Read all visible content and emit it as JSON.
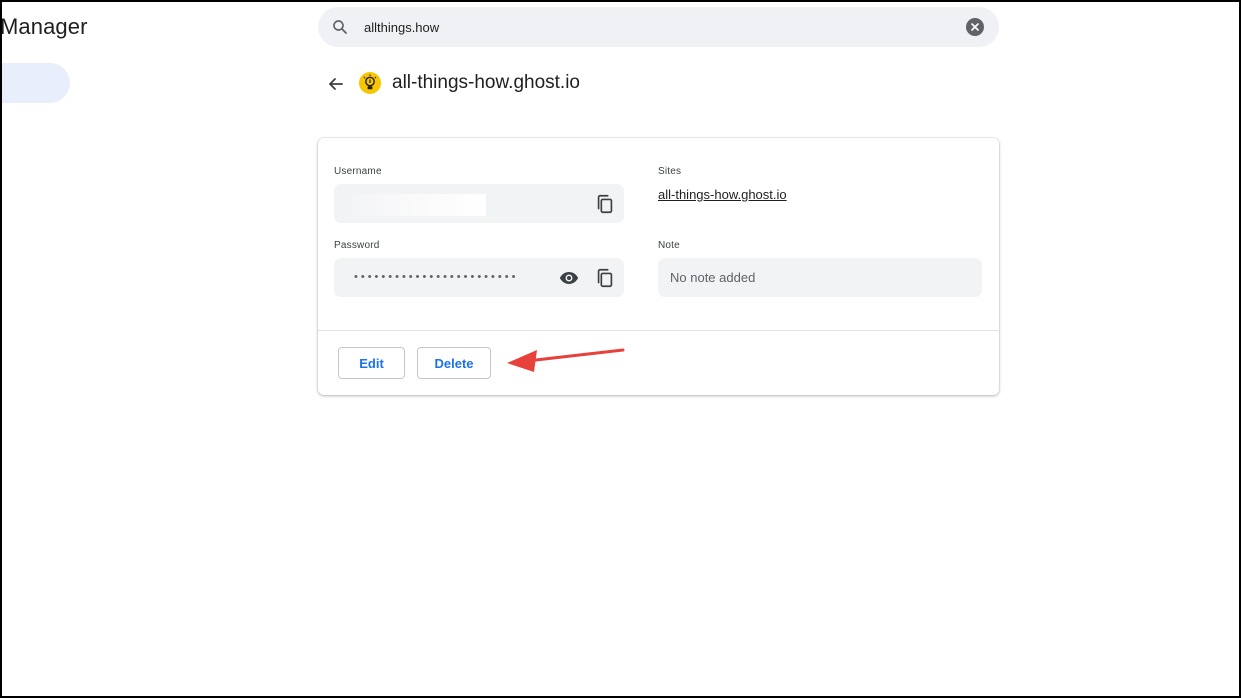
{
  "app": {
    "title": "Manager"
  },
  "search": {
    "value": "allthings.how"
  },
  "detail": {
    "site_title": "all-things-how.ghost.io",
    "username_label": "Username",
    "password_label": "Password",
    "password_mask": "••••••••••••••••••••••••",
    "sites_label": "Sites",
    "site_link": "all-things-how.ghost.io",
    "note_label": "Note",
    "note_placeholder": "No note added"
  },
  "actions": {
    "edit_label": "Edit",
    "delete_label": "Delete"
  },
  "colors": {
    "accent": "#1a73e8",
    "annotation_arrow": "#e8413c",
    "logo": "#f7c600"
  },
  "icons": [
    "search-icon",
    "clear-icon",
    "back-arrow-icon",
    "site-logo-icon",
    "copy-icon",
    "eye-icon"
  ]
}
